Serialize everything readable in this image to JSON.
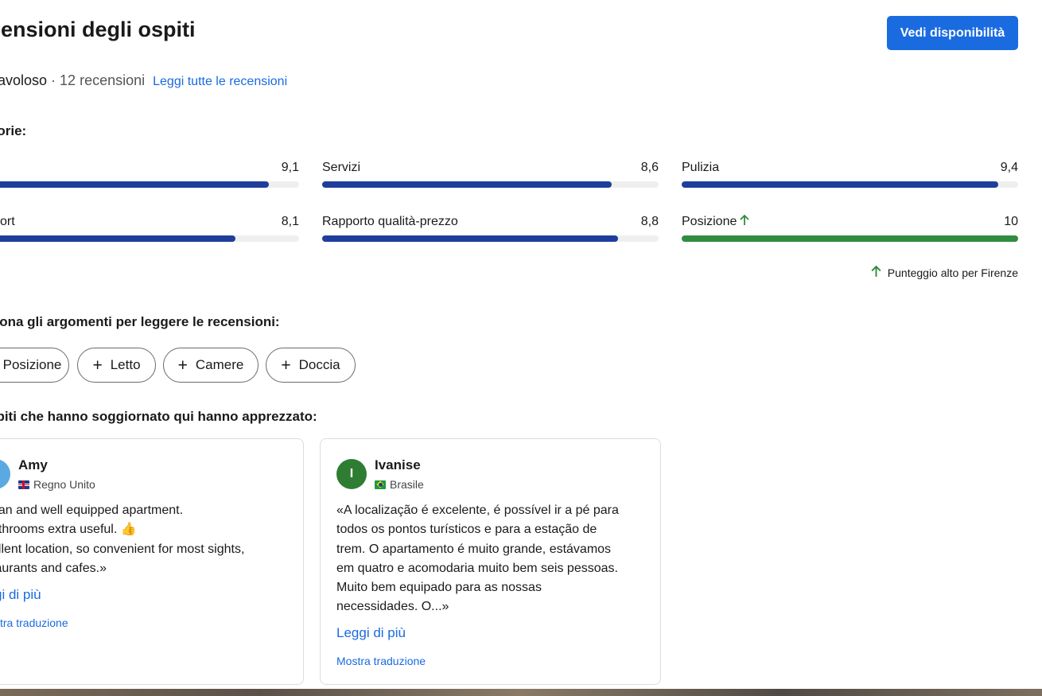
{
  "header": {
    "title": "censioni degli ospiti",
    "cta_label": "Vedi disponibilità"
  },
  "summary": {
    "rating_word": "Favoloso",
    "separator": "·",
    "review_count": "12 recensioni",
    "read_all_link": "Leggi tutte le recensioni"
  },
  "categories": {
    "heading": "gorie:",
    "items": [
      {
        "label": "",
        "score": "9,1",
        "fill": 0.91,
        "color": "#1f3e9c"
      },
      {
        "label": "Servizi",
        "score": "8,6",
        "fill": 0.86,
        "color": "#1f3e9c"
      },
      {
        "label": "Pulizia",
        "score": "9,4",
        "fill": 0.94,
        "color": "#1f3e9c"
      },
      {
        "label": "ort",
        "score": "8,1",
        "fill": 0.81,
        "color": "#1f3e9c"
      },
      {
        "label": "Rapporto qualità-prezzo",
        "score": "8,8",
        "fill": 0.88,
        "color": "#1f3e9c"
      },
      {
        "label": "Posizione",
        "score": "10",
        "fill": 1.0,
        "color": "#308c3e",
        "badge": "arrow-up-icon"
      }
    ],
    "high_score_note": "Punteggio alto per Firenze"
  },
  "topics": {
    "heading": "ziona gli argomenti per leggere le recensioni:",
    "chips": [
      {
        "label": "Posizione",
        "icon": "plus-icon"
      },
      {
        "label": "Letto",
        "icon": "plus-icon"
      },
      {
        "label": "Camere",
        "icon": "plus-icon"
      },
      {
        "label": "Doccia",
        "icon": "plus-icon"
      }
    ]
  },
  "liked": {
    "heading": "spiti che hanno soggiornato qui hanno apprezzato:",
    "reviews": [
      {
        "name": "Amy",
        "initial": "",
        "avatar_color": "#5aa9e0",
        "country": "Regno Unito",
        "flag": "uk-flag-icon",
        "text": "ean and well equipped apartment.\nathrooms extra useful. 👍\nellent location, so convenient for most sights,\ntaurants and cafes.»",
        "read_more": "gi di più",
        "translate": "stra traduzione"
      },
      {
        "name": "Ivanise",
        "initial": "I",
        "avatar_color": "#2e7d32",
        "country": "Brasile",
        "flag": "brazil-flag-icon",
        "text": "«A localização é excelente, é possível ir a pé para\ntodos os pontos turísticos e para a estação de\ntrem. O apartamento é muito grande, estávamos\nem quatro e acomodaria muito bem seis pessoas.\nMuito bem equipado para as nossas\nnecessidades. O...»",
        "read_more": "Leggi di più",
        "translate": "Mostra traduzione"
      }
    ]
  }
}
